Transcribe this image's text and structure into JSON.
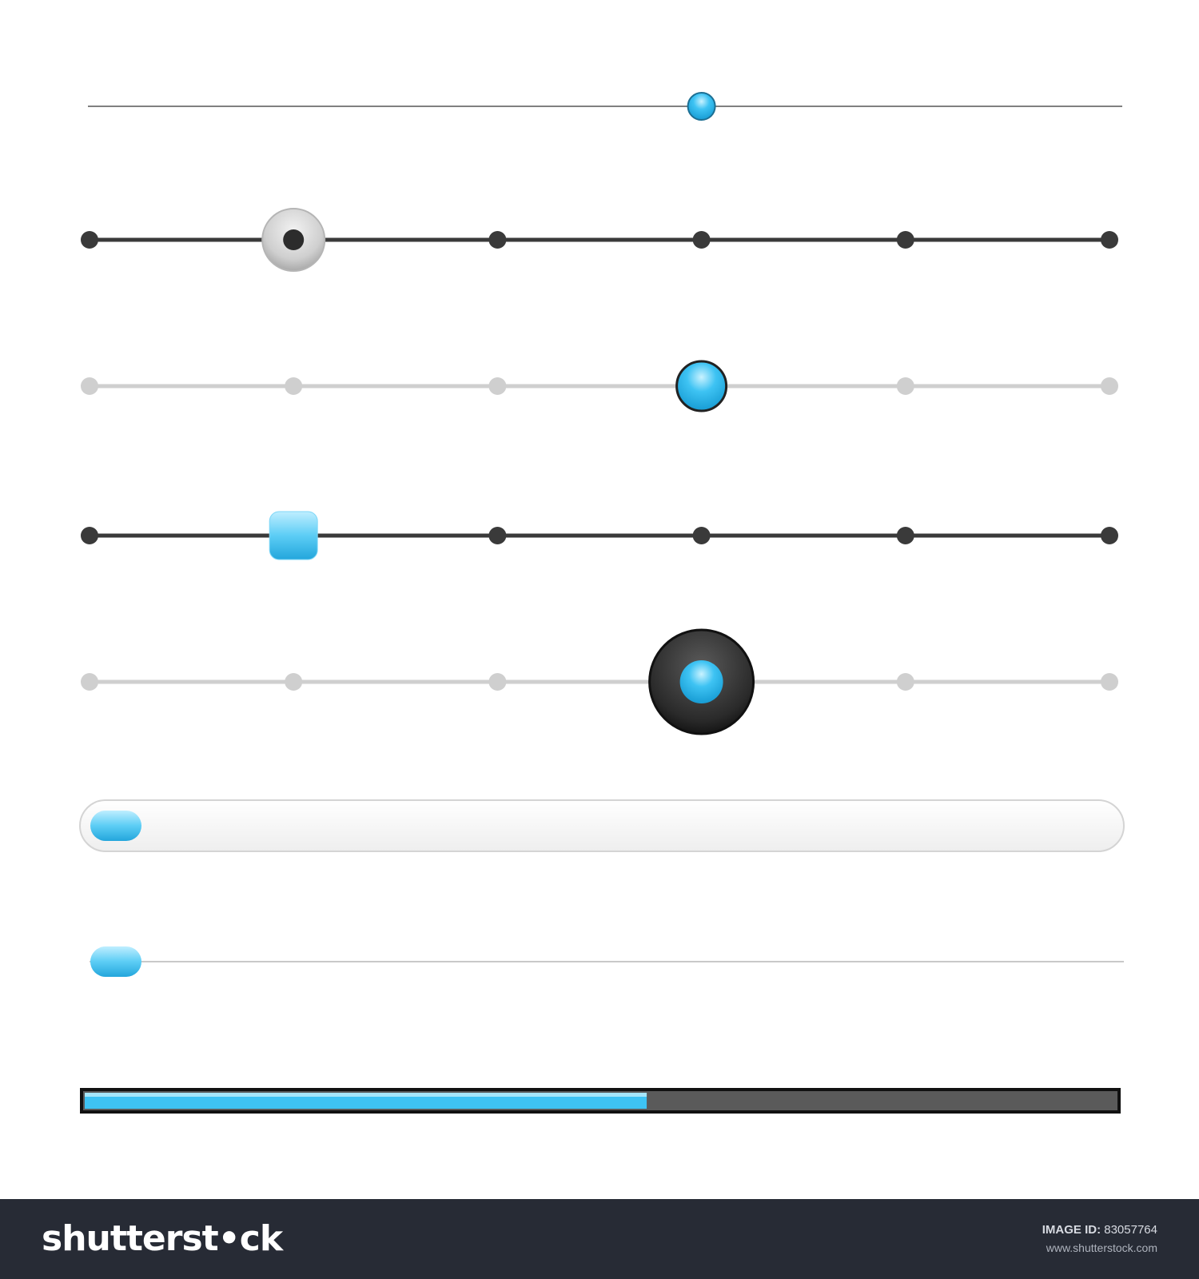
{
  "palette": {
    "blue": "#3ec3f3",
    "blue_light": "#bfeeff",
    "blue_dark": "#1398cf",
    "dark": "#3a3a3a",
    "gray_line": "#808080",
    "light_gray": "#cfcfcf",
    "footer_bg": "#272b35"
  },
  "sliders": [
    {
      "id": "slider-thin-blue",
      "style": "thin-line-small-blue-knob",
      "steps": 0,
      "value": 0.6
    },
    {
      "id": "slider-dark-stepped-gray-knob",
      "style": "dark-dots-gray-ring-knob",
      "steps": 6,
      "value": 0.2
    },
    {
      "id": "slider-light-stepped-blue-knob",
      "style": "light-dots-blue-knob",
      "steps": 6,
      "value": 0.6
    },
    {
      "id": "slider-dark-stepped-square-knob",
      "style": "dark-dots-blue-square-knob",
      "steps": 6,
      "value": 0.2
    },
    {
      "id": "slider-light-stepped-big-dark-knob",
      "style": "light-dots-big-dark-knob",
      "steps": 6,
      "value": 0.6
    },
    {
      "id": "slider-rounded-track-pill",
      "style": "rounded-track-blue-pill",
      "steps": 0,
      "value": 0.0
    },
    {
      "id": "slider-thin-line-pill",
      "style": "thin-line-blue-pill",
      "steps": 0,
      "value": 0.0
    },
    {
      "id": "progress-bar",
      "style": "dark-progress-bar",
      "steps": 0,
      "value": 0.545
    }
  ],
  "footer": {
    "logo_text": "shutterst•ck",
    "image_id_label": "IMAGE ID:",
    "image_id_value": "83057764",
    "site_url": "www.shutterstock.com"
  }
}
